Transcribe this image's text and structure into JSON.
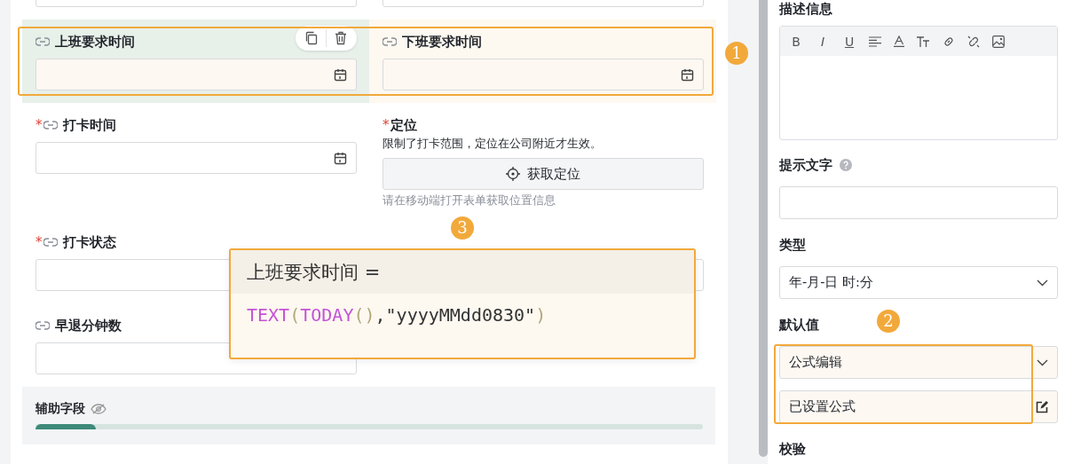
{
  "form": {
    "fields": [
      {
        "label": "上班要求时间",
        "kind": "date",
        "link": true,
        "selected": true,
        "highlighted": true
      },
      {
        "label": "下班要求时间",
        "kind": "date",
        "link": true,
        "selected": false,
        "highlighted": true
      },
      {
        "label": "打卡时间",
        "kind": "date",
        "required_mark": "*",
        "link": true,
        "selected": false,
        "highlighted": false
      },
      {
        "label": "定位",
        "kind": "location",
        "required_mark": "*",
        "link": false,
        "selected": false,
        "highlighted": false,
        "description": "限制了打卡范围，定位在公司附近才生效。",
        "button": "获取定位",
        "hint": "请在移动端打开表单获取位置信息"
      },
      {
        "label": "打卡状态",
        "kind": "text",
        "required_mark": "*",
        "link": true,
        "selected": false,
        "highlighted": false
      },
      {
        "kind": "text",
        "link": false,
        "selected": false,
        "highlighted": false
      },
      {
        "label": "早退分钟数",
        "kind": "text",
        "link": true,
        "selected": false,
        "highlighted": false
      }
    ],
    "auxiliary": {
      "label": "辅助字段",
      "hidden": true,
      "level": 0.09
    }
  },
  "properties": {
    "description": {
      "label": "描述信息",
      "toolbar": [
        {
          "kind": "char",
          "text": "B",
          "italic": false,
          "underline": false
        },
        {
          "kind": "char",
          "text": "I",
          "italic": true,
          "underline": false
        },
        {
          "kind": "char",
          "text": "U",
          "italic": false,
          "underline": true
        },
        {
          "kind": "align"
        },
        {
          "kind": "font-color"
        },
        {
          "kind": "text-size"
        },
        {
          "kind": "link"
        },
        {
          "kind": "unlink"
        },
        {
          "kind": "image"
        }
      ]
    },
    "placeholder_text": {
      "label": "提示文字",
      "help": true
    },
    "type": {
      "label": "类型",
      "value": "年-月-日 时:分"
    },
    "default_value": {
      "label": "默认值",
      "mode": "公式编辑",
      "formula": "已设置公式"
    },
    "validation": {
      "label": "校验"
    }
  },
  "annotations": [
    {
      "number": "1"
    },
    {
      "number": "2"
    },
    {
      "number": "3"
    }
  ],
  "formula_popup": {
    "title": "上班要求时间 =",
    "tokens": [
      {
        "text": "TEXT",
        "kind": "function"
      },
      {
        "text": "(",
        "kind": "paren"
      },
      {
        "text": "TODAY",
        "kind": "function"
      },
      {
        "text": "()",
        "kind": "paren"
      },
      {
        "text": ",\"yyyyMMdd0830\"",
        "kind": "string"
      },
      {
        "text": ")",
        "kind": "paren"
      }
    ]
  }
}
